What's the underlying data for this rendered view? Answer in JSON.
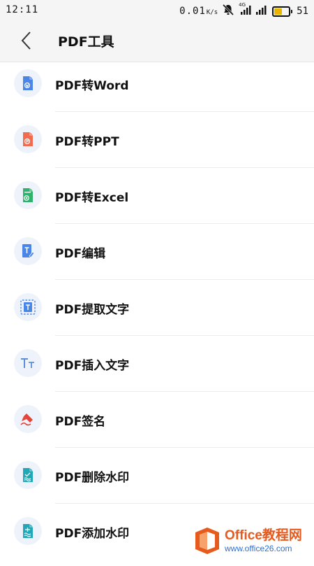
{
  "status_bar": {
    "time": "12:11",
    "speed": "0.01",
    "speed_unit": "K/s",
    "network_label": "4G",
    "battery": "51",
    "battery_level": 0.51,
    "battery_color": "#e8b400"
  },
  "header": {
    "title": "PDF工具",
    "back_icon": "chevron-left-icon"
  },
  "tools": [
    {
      "label": "PDF转Word",
      "icon": "word-document-icon",
      "color": "#4a86e8"
    },
    {
      "label": "PDF转PPT",
      "icon": "ppt-document-icon",
      "color": "#f26b4f"
    },
    {
      "label": "PDF转Excel",
      "icon": "excel-document-icon",
      "color": "#2db36b"
    },
    {
      "label": "PDF编辑",
      "icon": "edit-document-icon",
      "color": "#4a86e8"
    },
    {
      "label": "PDF提取文字",
      "icon": "extract-text-icon",
      "color": "#4a86e8"
    },
    {
      "label": "PDF插入文字",
      "icon": "insert-text-icon",
      "color": "#5b8fd8"
    },
    {
      "label": "PDF签名",
      "icon": "signature-pen-icon",
      "color": "#e0443a"
    },
    {
      "label": "PDF删除水印",
      "icon": "remove-watermark-icon",
      "color": "#1fa8b5"
    },
    {
      "label": "PDF添加水印",
      "icon": "add-watermark-icon",
      "color": "#1fa8b5"
    }
  ],
  "watermark": {
    "brand": "Office教程网",
    "url": "www.office26.com",
    "colors": {
      "primary": "#e65a1e",
      "secondary": "#2d6fd1"
    }
  }
}
